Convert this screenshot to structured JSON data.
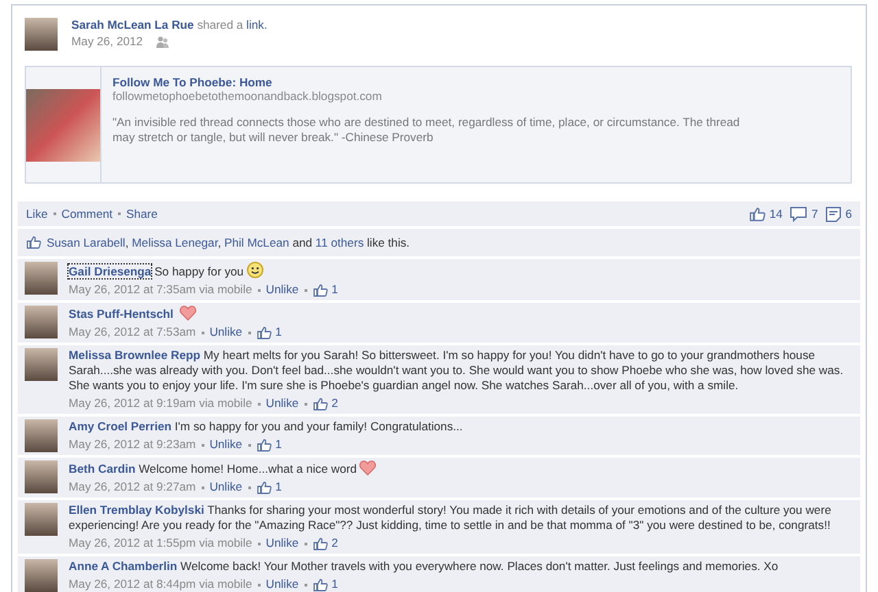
{
  "post": {
    "author": "Sarah McLean La Rue",
    "verb": "shared a",
    "object": "link.",
    "date": "May 26, 2012"
  },
  "link_preview": {
    "title": "Follow Me To Phoebe: Home",
    "url": "followmetophoebetothemoonandback.blogspot.com",
    "quote": "\"An invisible red thread connects those who are destined to meet, regardless of time, place, or circumstance. The thread may stretch or tangle, but will never break.\" -Chinese Proverb"
  },
  "actions": [
    "Like",
    "Comment",
    "Share"
  ],
  "counts": [
    {
      "kind": "likes",
      "value": "14"
    },
    {
      "kind": "comments",
      "value": "7"
    },
    {
      "kind": "shares",
      "value": "6"
    }
  ],
  "likes": {
    "names": [
      "Susan Larabell",
      "Melissa Lenegar",
      "Phil McLean"
    ],
    "separator": ",",
    "conjunction": "and",
    "others": "11 others",
    "suffix": "like this."
  },
  "comments": [
    {
      "name": "Gail Driesenga",
      "text": "So happy for you",
      "emoji": {
        "kind": "smile"
      },
      "focused": true,
      "time": "May 26, 2012 at 7:35am via mobile",
      "action": "Unlike",
      "likes": "1"
    },
    {
      "name": "Stas Puff-Hentschl",
      "emoji": {
        "kind": "heart"
      },
      "focused": false,
      "time": "May 26, 2012 at 7:53am",
      "action": "Unlike",
      "likes": "1"
    },
    {
      "name": "Melissa Brownlee Repp",
      "text": "My heart melts for you Sarah! So bittersweet. I'm so happy for you! You didn't have to go to your grandmothers house Sarah....she was already with you. Don't feel bad...she wouldn't want you to. She would want you to show Phoebe who she was, how loved she was. She wants you to enjoy your life. I'm sure she is Phoebe's guardian angel now. She watches Sarah...over all of you, with a smile.",
      "focused": false,
      "time": "May 26, 2012 at 9:19am via mobile",
      "action": "Unlike",
      "likes": "2"
    },
    {
      "name": "Amy Croel Perrien",
      "text": "I'm so happy for you and your family! Congratulations...",
      "focused": false,
      "time": "May 26, 2012 at 9:23am",
      "action": "Unlike",
      "likes": "1"
    },
    {
      "name": "Beth Cardin",
      "text": "Welcome home! Home...what a nice word",
      "emoji": {
        "kind": "heart"
      },
      "focused": false,
      "time": "May 26, 2012 at 9:27am",
      "action": "Unlike",
      "likes": "1"
    },
    {
      "name": "Ellen Tremblay Kobylski",
      "text": "Thanks for sharing your most wonderful story! You made it rich with details of your emotions and of the culture you were experiencing! Are you ready for the \"Amazing Race\"?? Just kidding, time to settle in and be that momma of \"3\" you were destined to be, congrats!!",
      "focused": false,
      "time": "May 26, 2012 at 1:55pm via mobile",
      "action": "Unlike",
      "likes": "2"
    },
    {
      "name": "Anne A Chamberlin",
      "text": "Welcome back! Your Mother travels with you everywhere now. Places don't matter. Just feelings and memories. Xo",
      "focused": false,
      "time": "May 26, 2012 at 8:44pm via mobile",
      "action": "Unlike",
      "likes": "1"
    }
  ]
}
